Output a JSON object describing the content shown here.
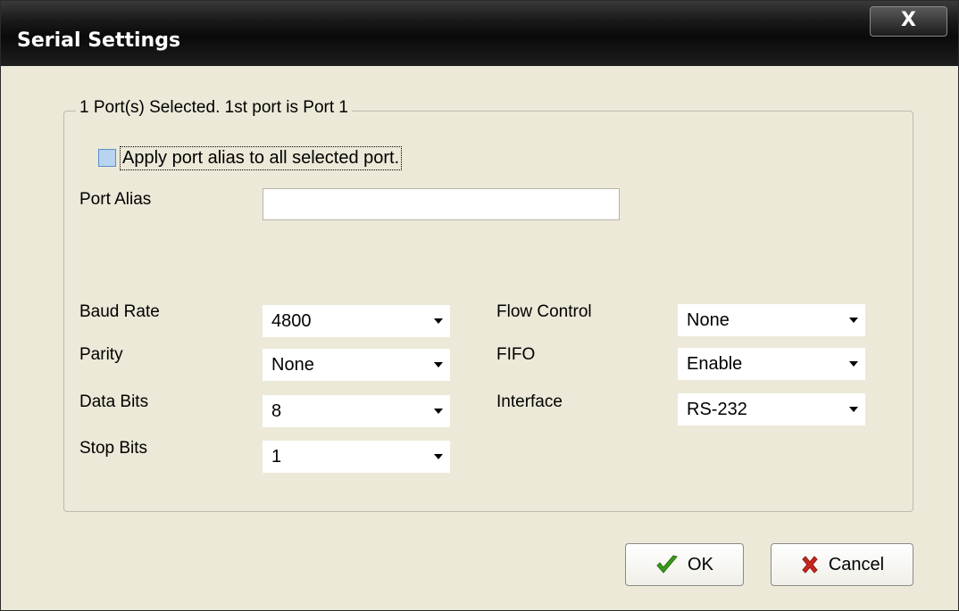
{
  "window": {
    "title": "Serial Settings",
    "close_label": "X"
  },
  "group": {
    "title": "1 Port(s) Selected. 1st port is Port 1",
    "apply_alias_label": "Apply port alias to all selected port.",
    "port_alias_label": "Port Alias",
    "port_alias_value": ""
  },
  "fields": {
    "baud_rate": {
      "label": "Baud Rate",
      "value": "4800"
    },
    "parity": {
      "label": "Parity",
      "value": "None"
    },
    "data_bits": {
      "label": "Data Bits",
      "value": "8"
    },
    "stop_bits": {
      "label": "Stop Bits",
      "value": "1"
    },
    "flow_control": {
      "label": "Flow Control",
      "value": "None"
    },
    "fifo": {
      "label": "FIFO",
      "value": "Enable"
    },
    "interface": {
      "label": "Interface",
      "value": "RS-232"
    }
  },
  "buttons": {
    "ok_label": "OK",
    "cancel_label": "Cancel"
  },
  "icons": {
    "ok": "checkmark-icon",
    "cancel": "red-x-icon"
  },
  "colors": {
    "checkmark": "#3a9a1a",
    "cancel_x": "#c8281e",
    "checkbox_fill": "#b8d4f0"
  }
}
